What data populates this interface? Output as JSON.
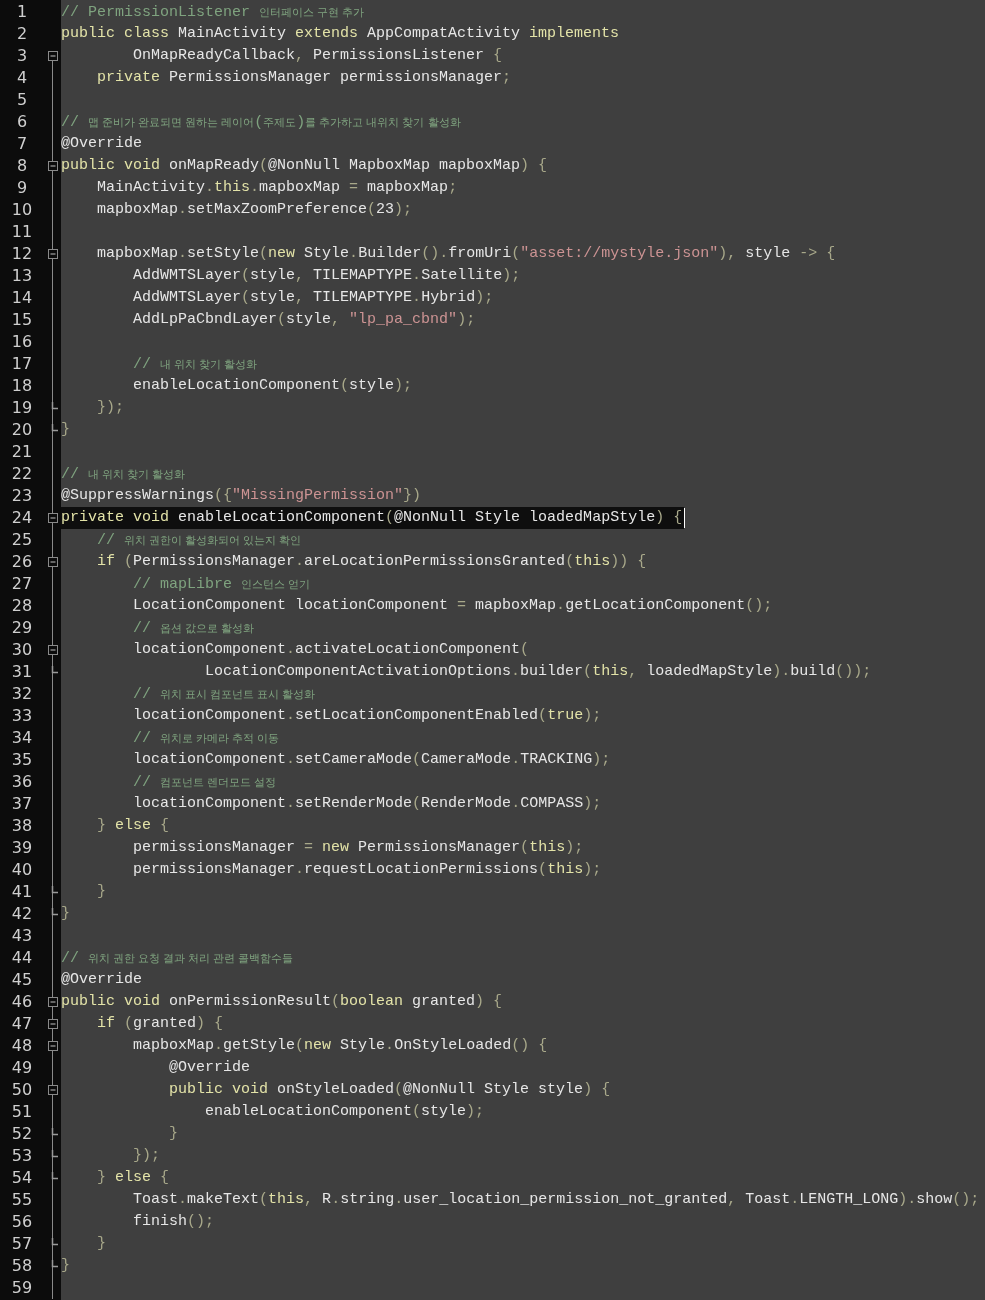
{
  "editor": {
    "lines": [
      {
        "number": "1",
        "current": false,
        "collapsible": false,
        "closes_block": false,
        "tokens": [
          {
            "kind": "comment",
            "text": "// PermissionListener "
          },
          {
            "kind": "comment_hangul",
            "text": "인터페이스 구현 추가"
          }
        ]
      },
      {
        "number": "2",
        "current": false,
        "collapsible": false,
        "closes_block": false,
        "tokens": [
          {
            "kind": "keyword",
            "text": "public class "
          },
          {
            "kind": "identifier",
            "text": "MainActivity "
          },
          {
            "kind": "keyword",
            "text": "extends "
          },
          {
            "kind": "identifier",
            "text": "AppCompatActivity "
          },
          {
            "kind": "keyword",
            "text": "implements"
          }
        ]
      },
      {
        "number": "3",
        "current": false,
        "collapsible": true,
        "closes_block": false,
        "tokens": [
          {
            "kind": "identifier",
            "text": "        OnMapReadyCallback"
          },
          {
            "kind": "punctuation",
            "text": ", "
          },
          {
            "kind": "identifier",
            "text": "PermissionsListener "
          },
          {
            "kind": "punctuation",
            "text": "{"
          }
        ]
      },
      {
        "number": "4",
        "current": false,
        "collapsible": false,
        "closes_block": false,
        "tokens": [
          {
            "kind": "keyword",
            "text": "    private "
          },
          {
            "kind": "identifier",
            "text": "PermissionsManager permissionsManager"
          },
          {
            "kind": "punctuation",
            "text": ";"
          }
        ]
      },
      {
        "number": "5",
        "current": false,
        "collapsible": false,
        "closes_block": false
      },
      {
        "number": "6",
        "current": false,
        "collapsible": false,
        "closes_block": false,
        "tokens": [
          {
            "kind": "comment",
            "text": "// "
          },
          {
            "kind": "comment_hangul",
            "text": "맵 준비가 완료되면 원하는 레이어"
          },
          {
            "kind": "comment",
            "text": "("
          },
          {
            "kind": "comment_hangul",
            "text": "주제도"
          },
          {
            "kind": "comment",
            "text": ")"
          },
          {
            "kind": "comment_hangul",
            "text": "를 추가하고 내위치 찾기 활성화"
          }
        ]
      },
      {
        "number": "7",
        "current": false,
        "collapsible": false,
        "closes_block": false,
        "tokens": [
          {
            "kind": "identifier",
            "text": "@Override"
          }
        ]
      },
      {
        "number": "8",
        "current": false,
        "collapsible": true,
        "closes_block": false,
        "tokens": [
          {
            "kind": "keyword",
            "text": "public void "
          },
          {
            "kind": "identifier",
            "text": "onMapReady"
          },
          {
            "kind": "punctuation",
            "text": "("
          },
          {
            "kind": "identifier",
            "text": "@NonNull MapboxMap mapboxMap"
          },
          {
            "kind": "punctuation",
            "text": ") {"
          }
        ]
      },
      {
        "number": "9",
        "current": false,
        "collapsible": false,
        "closes_block": false,
        "tokens": [
          {
            "kind": "identifier",
            "text": "    MainActivity"
          },
          {
            "kind": "punctuation",
            "text": "."
          },
          {
            "kind": "keyword",
            "text": "this"
          },
          {
            "kind": "punctuation",
            "text": "."
          },
          {
            "kind": "identifier",
            "text": "mapboxMap "
          },
          {
            "kind": "punctuation",
            "text": "= "
          },
          {
            "kind": "identifier",
            "text": "mapboxMap"
          },
          {
            "kind": "punctuation",
            "text": ";"
          }
        ]
      },
      {
        "number": "10",
        "current": false,
        "collapsible": false,
        "closes_block": false,
        "tokens": [
          {
            "kind": "identifier",
            "text": "    mapboxMap"
          },
          {
            "kind": "punctuation",
            "text": "."
          },
          {
            "kind": "identifier",
            "text": "setMaxZoomPreference"
          },
          {
            "kind": "punctuation",
            "text": "("
          },
          {
            "kind": "identifier",
            "text": "23"
          },
          {
            "kind": "punctuation",
            "text": ");"
          }
        ]
      },
      {
        "number": "11",
        "current": false,
        "collapsible": false,
        "closes_block": false
      },
      {
        "number": "12",
        "current": false,
        "collapsible": true,
        "closes_block": false,
        "tokens": [
          {
            "kind": "identifier",
            "text": "    mapboxMap"
          },
          {
            "kind": "punctuation",
            "text": "."
          },
          {
            "kind": "identifier",
            "text": "setStyle"
          },
          {
            "kind": "punctuation",
            "text": "("
          },
          {
            "kind": "keyword",
            "text": "new "
          },
          {
            "kind": "identifier",
            "text": "Style"
          },
          {
            "kind": "punctuation",
            "text": "."
          },
          {
            "kind": "identifier",
            "text": "Builder"
          },
          {
            "kind": "punctuation",
            "text": "()."
          },
          {
            "kind": "identifier",
            "text": "fromUri"
          },
          {
            "kind": "punctuation",
            "text": "("
          },
          {
            "kind": "string",
            "text": "\"asset://mystyle.json\""
          },
          {
            "kind": "punctuation",
            "text": "), "
          },
          {
            "kind": "identifier",
            "text": "style "
          },
          {
            "kind": "punctuation",
            "text": "-> {"
          }
        ]
      },
      {
        "number": "13",
        "current": false,
        "collapsible": false,
        "closes_block": false,
        "tokens": [
          {
            "kind": "identifier",
            "text": "        AddWMTSLayer"
          },
          {
            "kind": "punctuation",
            "text": "("
          },
          {
            "kind": "identifier",
            "text": "style"
          },
          {
            "kind": "punctuation",
            "text": ", "
          },
          {
            "kind": "identifier",
            "text": "TILEMAPTYPE"
          },
          {
            "kind": "punctuation",
            "text": "."
          },
          {
            "kind": "identifier",
            "text": "Satellite"
          },
          {
            "kind": "punctuation",
            "text": ");"
          }
        ]
      },
      {
        "number": "14",
        "current": false,
        "collapsible": false,
        "closes_block": false,
        "tokens": [
          {
            "kind": "identifier",
            "text": "        AddWMTSLayer"
          },
          {
            "kind": "punctuation",
            "text": "("
          },
          {
            "kind": "identifier",
            "text": "style"
          },
          {
            "kind": "punctuation",
            "text": ", "
          },
          {
            "kind": "identifier",
            "text": "TILEMAPTYPE"
          },
          {
            "kind": "punctuation",
            "text": "."
          },
          {
            "kind": "identifier",
            "text": "Hybrid"
          },
          {
            "kind": "punctuation",
            "text": ");"
          }
        ]
      },
      {
        "number": "15",
        "current": false,
        "collapsible": false,
        "closes_block": false,
        "tokens": [
          {
            "kind": "identifier",
            "text": "        AddLpPaCbndLayer"
          },
          {
            "kind": "punctuation",
            "text": "("
          },
          {
            "kind": "identifier",
            "text": "style"
          },
          {
            "kind": "punctuation",
            "text": ", "
          },
          {
            "kind": "string",
            "text": "\"lp_pa_cbnd\""
          },
          {
            "kind": "punctuation",
            "text": ");"
          }
        ]
      },
      {
        "number": "16",
        "current": false,
        "collapsible": false,
        "closes_block": false
      },
      {
        "number": "17",
        "current": false,
        "collapsible": false,
        "closes_block": false,
        "tokens": [
          {
            "kind": "comment",
            "text": "        // "
          },
          {
            "kind": "comment_hangul",
            "text": "내 위치 찾기 활성화"
          }
        ]
      },
      {
        "number": "18",
        "current": false,
        "collapsible": false,
        "closes_block": false,
        "tokens": [
          {
            "kind": "identifier",
            "text": "        enableLocationComponent"
          },
          {
            "kind": "punctuation",
            "text": "("
          },
          {
            "kind": "identifier",
            "text": "style"
          },
          {
            "kind": "punctuation",
            "text": ");"
          }
        ]
      },
      {
        "number": "19",
        "current": false,
        "collapsible": false,
        "closes_block": true,
        "tokens": [
          {
            "kind": "punctuation",
            "text": "    });"
          }
        ]
      },
      {
        "number": "20",
        "current": false,
        "collapsible": false,
        "closes_block": true,
        "tokens": [
          {
            "kind": "punctuation",
            "text": "}"
          }
        ]
      },
      {
        "number": "21",
        "current": false,
        "collapsible": false,
        "closes_block": false
      },
      {
        "number": "22",
        "current": false,
        "collapsible": false,
        "closes_block": false,
        "tokens": [
          {
            "kind": "comment",
            "text": "// "
          },
          {
            "kind": "comment_hangul",
            "text": "내 위치 찾기 활성화"
          }
        ]
      },
      {
        "number": "23",
        "current": false,
        "collapsible": false,
        "closes_block": false,
        "tokens": [
          {
            "kind": "identifier",
            "text": "@SuppressWarnings"
          },
          {
            "kind": "punctuation",
            "text": "({"
          },
          {
            "kind": "string",
            "text": "\"MissingPermission\""
          },
          {
            "kind": "punctuation",
            "text": "})"
          }
        ]
      },
      {
        "number": "24",
        "current": true,
        "collapsible": true,
        "closes_block": false,
        "tokens": [
          {
            "kind": "keyword",
            "text": "private void "
          },
          {
            "kind": "identifier",
            "text": "enableLocationComponent"
          },
          {
            "kind": "punctuation",
            "text": "("
          },
          {
            "kind": "identifier",
            "text": "@NonNull Style loadedMapStyle"
          },
          {
            "kind": "punctuation",
            "text": ") {"
          }
        ]
      },
      {
        "number": "25",
        "current": false,
        "collapsible": false,
        "closes_block": false,
        "tokens": [
          {
            "kind": "comment",
            "text": "    // "
          },
          {
            "kind": "comment_hangul",
            "text": "위치 권한이 활성화되어 있는지 확인"
          }
        ]
      },
      {
        "number": "26",
        "current": false,
        "collapsible": true,
        "closes_block": false,
        "tokens": [
          {
            "kind": "keyword",
            "text": "    if "
          },
          {
            "kind": "punctuation",
            "text": "("
          },
          {
            "kind": "identifier",
            "text": "PermissionsManager"
          },
          {
            "kind": "punctuation",
            "text": "."
          },
          {
            "kind": "identifier",
            "text": "areLocationPermissionsGranted"
          },
          {
            "kind": "punctuation",
            "text": "("
          },
          {
            "kind": "keyword",
            "text": "this"
          },
          {
            "kind": "punctuation",
            "text": ")) {"
          }
        ]
      },
      {
        "number": "27",
        "current": false,
        "collapsible": false,
        "closes_block": false,
        "tokens": [
          {
            "kind": "comment",
            "text": "        // mapLibre "
          },
          {
            "kind": "comment_hangul",
            "text": "인스턴스 얻기"
          }
        ]
      },
      {
        "number": "28",
        "current": false,
        "collapsible": false,
        "closes_block": false,
        "tokens": [
          {
            "kind": "identifier",
            "text": "        LocationComponent locationComponent "
          },
          {
            "kind": "punctuation",
            "text": "= "
          },
          {
            "kind": "identifier",
            "text": "mapboxMap"
          },
          {
            "kind": "punctuation",
            "text": "."
          },
          {
            "kind": "identifier",
            "text": "getLocationComponent"
          },
          {
            "kind": "punctuation",
            "text": "();"
          }
        ]
      },
      {
        "number": "29",
        "current": false,
        "collapsible": false,
        "closes_block": false,
        "tokens": [
          {
            "kind": "comment",
            "text": "        // "
          },
          {
            "kind": "comment_hangul",
            "text": "옵션 값으로 활성화"
          }
        ]
      },
      {
        "number": "30",
        "current": false,
        "collapsible": true,
        "closes_block": false,
        "tokens": [
          {
            "kind": "identifier",
            "text": "        locationComponent"
          },
          {
            "kind": "punctuation",
            "text": "."
          },
          {
            "kind": "identifier",
            "text": "activateLocationComponent"
          },
          {
            "kind": "punctuation",
            "text": "("
          }
        ]
      },
      {
        "number": "31",
        "current": false,
        "collapsible": false,
        "closes_block": true,
        "tokens": [
          {
            "kind": "identifier",
            "text": "                LocationComponentActivationOptions"
          },
          {
            "kind": "punctuation",
            "text": "."
          },
          {
            "kind": "identifier",
            "text": "builder"
          },
          {
            "kind": "punctuation",
            "text": "("
          },
          {
            "kind": "keyword",
            "text": "this"
          },
          {
            "kind": "punctuation",
            "text": ", "
          },
          {
            "kind": "identifier",
            "text": "loadedMapStyle"
          },
          {
            "kind": "punctuation",
            "text": ")."
          },
          {
            "kind": "identifier",
            "text": "build"
          },
          {
            "kind": "punctuation",
            "text": "());"
          }
        ]
      },
      {
        "number": "32",
        "current": false,
        "collapsible": false,
        "closes_block": false,
        "tokens": [
          {
            "kind": "comment",
            "text": "        // "
          },
          {
            "kind": "comment_hangul",
            "text": "위치 표시 컴포넌트 표시 활성화"
          }
        ]
      },
      {
        "number": "33",
        "current": false,
        "collapsible": false,
        "closes_block": false,
        "tokens": [
          {
            "kind": "identifier",
            "text": "        locationComponent"
          },
          {
            "kind": "punctuation",
            "text": "."
          },
          {
            "kind": "identifier",
            "text": "setLocationComponentEnabled"
          },
          {
            "kind": "punctuation",
            "text": "("
          },
          {
            "kind": "keyword",
            "text": "true"
          },
          {
            "kind": "punctuation",
            "text": ");"
          }
        ]
      },
      {
        "number": "34",
        "current": false,
        "collapsible": false,
        "closes_block": false,
        "tokens": [
          {
            "kind": "comment",
            "text": "        // "
          },
          {
            "kind": "comment_hangul",
            "text": "위치로 카메라 추적 이동"
          }
        ]
      },
      {
        "number": "35",
        "current": false,
        "collapsible": false,
        "closes_block": false,
        "tokens": [
          {
            "kind": "identifier",
            "text": "        locationComponent"
          },
          {
            "kind": "punctuation",
            "text": "."
          },
          {
            "kind": "identifier",
            "text": "setCameraMode"
          },
          {
            "kind": "punctuation",
            "text": "("
          },
          {
            "kind": "identifier",
            "text": "CameraMode"
          },
          {
            "kind": "punctuation",
            "text": "."
          },
          {
            "kind": "identifier",
            "text": "TRACKING"
          },
          {
            "kind": "punctuation",
            "text": ");"
          }
        ]
      },
      {
        "number": "36",
        "current": false,
        "collapsible": false,
        "closes_block": false,
        "tokens": [
          {
            "kind": "comment",
            "text": "        // "
          },
          {
            "kind": "comment_hangul",
            "text": "컴포넌트 렌더모드 설정"
          }
        ]
      },
      {
        "number": "37",
        "current": false,
        "collapsible": false,
        "closes_block": false,
        "tokens": [
          {
            "kind": "identifier",
            "text": "        locationComponent"
          },
          {
            "kind": "punctuation",
            "text": "."
          },
          {
            "kind": "identifier",
            "text": "setRenderMode"
          },
          {
            "kind": "punctuation",
            "text": "("
          },
          {
            "kind": "identifier",
            "text": "RenderMode"
          },
          {
            "kind": "punctuation",
            "text": "."
          },
          {
            "kind": "identifier",
            "text": "COMPASS"
          },
          {
            "kind": "punctuation",
            "text": ");"
          }
        ]
      },
      {
        "number": "38",
        "current": false,
        "collapsible": false,
        "closes_block": false,
        "tokens": [
          {
            "kind": "punctuation",
            "text": "    } "
          },
          {
            "kind": "keyword",
            "text": "else "
          },
          {
            "kind": "punctuation",
            "text": "{"
          }
        ]
      },
      {
        "number": "39",
        "current": false,
        "collapsible": false,
        "closes_block": false,
        "tokens": [
          {
            "kind": "identifier",
            "text": "        permissionsManager "
          },
          {
            "kind": "punctuation",
            "text": "= "
          },
          {
            "kind": "keyword",
            "text": "new "
          },
          {
            "kind": "identifier",
            "text": "PermissionsManager"
          },
          {
            "kind": "punctuation",
            "text": "("
          },
          {
            "kind": "keyword",
            "text": "this"
          },
          {
            "kind": "punctuation",
            "text": ");"
          }
        ]
      },
      {
        "number": "40",
        "current": false,
        "collapsible": false,
        "closes_block": false,
        "tokens": [
          {
            "kind": "identifier",
            "text": "        permissionsManager"
          },
          {
            "kind": "punctuation",
            "text": "."
          },
          {
            "kind": "identifier",
            "text": "requestLocationPermissions"
          },
          {
            "kind": "punctuation",
            "text": "("
          },
          {
            "kind": "keyword",
            "text": "this"
          },
          {
            "kind": "punctuation",
            "text": ");"
          }
        ]
      },
      {
        "number": "41",
        "current": false,
        "collapsible": false,
        "closes_block": true,
        "tokens": [
          {
            "kind": "punctuation",
            "text": "    }"
          }
        ]
      },
      {
        "number": "42",
        "current": false,
        "collapsible": false,
        "closes_block": true,
        "tokens": [
          {
            "kind": "punctuation",
            "text": "}"
          }
        ]
      },
      {
        "number": "43",
        "current": false,
        "collapsible": false,
        "closes_block": false
      },
      {
        "number": "44",
        "current": false,
        "collapsible": false,
        "closes_block": false,
        "tokens": [
          {
            "kind": "comment",
            "text": "// "
          },
          {
            "kind": "comment_hangul",
            "text": "위치 권한 요청 결과 처리 관련 콜백함수들"
          }
        ]
      },
      {
        "number": "45",
        "current": false,
        "collapsible": false,
        "closes_block": false,
        "tokens": [
          {
            "kind": "identifier",
            "text": "@Override"
          }
        ]
      },
      {
        "number": "46",
        "current": false,
        "collapsible": true,
        "closes_block": false,
        "tokens": [
          {
            "kind": "keyword",
            "text": "public void "
          },
          {
            "kind": "identifier",
            "text": "onPermissionResult"
          },
          {
            "kind": "punctuation",
            "text": "("
          },
          {
            "kind": "keyword",
            "text": "boolean "
          },
          {
            "kind": "identifier",
            "text": "granted"
          },
          {
            "kind": "punctuation",
            "text": ") {"
          }
        ]
      },
      {
        "number": "47",
        "current": false,
        "collapsible": true,
        "closes_block": false,
        "tokens": [
          {
            "kind": "keyword",
            "text": "    if "
          },
          {
            "kind": "punctuation",
            "text": "("
          },
          {
            "kind": "identifier",
            "text": "granted"
          },
          {
            "kind": "punctuation",
            "text": ") {"
          }
        ]
      },
      {
        "number": "48",
        "current": false,
        "collapsible": true,
        "closes_block": false,
        "tokens": [
          {
            "kind": "identifier",
            "text": "        mapboxMap"
          },
          {
            "kind": "punctuation",
            "text": "."
          },
          {
            "kind": "identifier",
            "text": "getStyle"
          },
          {
            "kind": "punctuation",
            "text": "("
          },
          {
            "kind": "keyword",
            "text": "new "
          },
          {
            "kind": "identifier",
            "text": "Style"
          },
          {
            "kind": "punctuation",
            "text": "."
          },
          {
            "kind": "identifier",
            "text": "OnStyleLoaded"
          },
          {
            "kind": "punctuation",
            "text": "() {"
          }
        ]
      },
      {
        "number": "49",
        "current": false,
        "collapsible": false,
        "closes_block": false,
        "tokens": [
          {
            "kind": "identifier",
            "text": "            @Override"
          }
        ]
      },
      {
        "number": "50",
        "current": false,
        "collapsible": true,
        "closes_block": false,
        "tokens": [
          {
            "kind": "keyword",
            "text": "            public void "
          },
          {
            "kind": "identifier",
            "text": "onStyleLoaded"
          },
          {
            "kind": "punctuation",
            "text": "("
          },
          {
            "kind": "identifier",
            "text": "@NonNull Style style"
          },
          {
            "kind": "punctuation",
            "text": ") {"
          }
        ]
      },
      {
        "number": "51",
        "current": false,
        "collapsible": false,
        "closes_block": false,
        "tokens": [
          {
            "kind": "identifier",
            "text": "                enableLocationComponent"
          },
          {
            "kind": "punctuation",
            "text": "("
          },
          {
            "kind": "identifier",
            "text": "style"
          },
          {
            "kind": "punctuation",
            "text": ");"
          }
        ]
      },
      {
        "number": "52",
        "current": false,
        "collapsible": false,
        "closes_block": true,
        "tokens": [
          {
            "kind": "punctuation",
            "text": "            }"
          }
        ]
      },
      {
        "number": "53",
        "current": false,
        "collapsible": false,
        "closes_block": true,
        "tokens": [
          {
            "kind": "punctuation",
            "text": "        });"
          }
        ]
      },
      {
        "number": "54",
        "current": false,
        "collapsible": false,
        "closes_block": true,
        "tokens": [
          {
            "kind": "punctuation",
            "text": "    } "
          },
          {
            "kind": "keyword",
            "text": "else "
          },
          {
            "kind": "punctuation",
            "text": "{"
          }
        ]
      },
      {
        "number": "55",
        "current": false,
        "collapsible": false,
        "closes_block": false,
        "tokens": [
          {
            "kind": "identifier",
            "text": "        Toast"
          },
          {
            "kind": "punctuation",
            "text": "."
          },
          {
            "kind": "identifier",
            "text": "makeText"
          },
          {
            "kind": "punctuation",
            "text": "("
          },
          {
            "kind": "keyword",
            "text": "this"
          },
          {
            "kind": "punctuation",
            "text": ", "
          },
          {
            "kind": "identifier",
            "text": "R"
          },
          {
            "kind": "punctuation",
            "text": "."
          },
          {
            "kind": "identifier",
            "text": "string"
          },
          {
            "kind": "punctuation",
            "text": "."
          },
          {
            "kind": "identifier",
            "text": "user_location_permission_not_granted"
          },
          {
            "kind": "punctuation",
            "text": ", "
          },
          {
            "kind": "identifier",
            "text": "Toast"
          },
          {
            "kind": "punctuation",
            "text": "."
          },
          {
            "kind": "identifier",
            "text": "LENGTH_LONG"
          },
          {
            "kind": "punctuation",
            "text": ")."
          },
          {
            "kind": "identifier",
            "text": "show"
          },
          {
            "kind": "punctuation",
            "text": "();"
          }
        ]
      },
      {
        "number": "56",
        "current": false,
        "collapsible": false,
        "closes_block": false,
        "tokens": [
          {
            "kind": "identifier",
            "text": "        finish"
          },
          {
            "kind": "punctuation",
            "text": "();"
          }
        ]
      },
      {
        "number": "57",
        "current": false,
        "collapsible": false,
        "closes_block": true,
        "tokens": [
          {
            "kind": "punctuation",
            "text": "    }"
          }
        ]
      },
      {
        "number": "58",
        "current": false,
        "collapsible": false,
        "closes_block": true,
        "tokens": [
          {
            "kind": "punctuation",
            "text": "}"
          }
        ]
      },
      {
        "number": "59",
        "current": false,
        "collapsible": false,
        "closes_block": false
      }
    ]
  }
}
